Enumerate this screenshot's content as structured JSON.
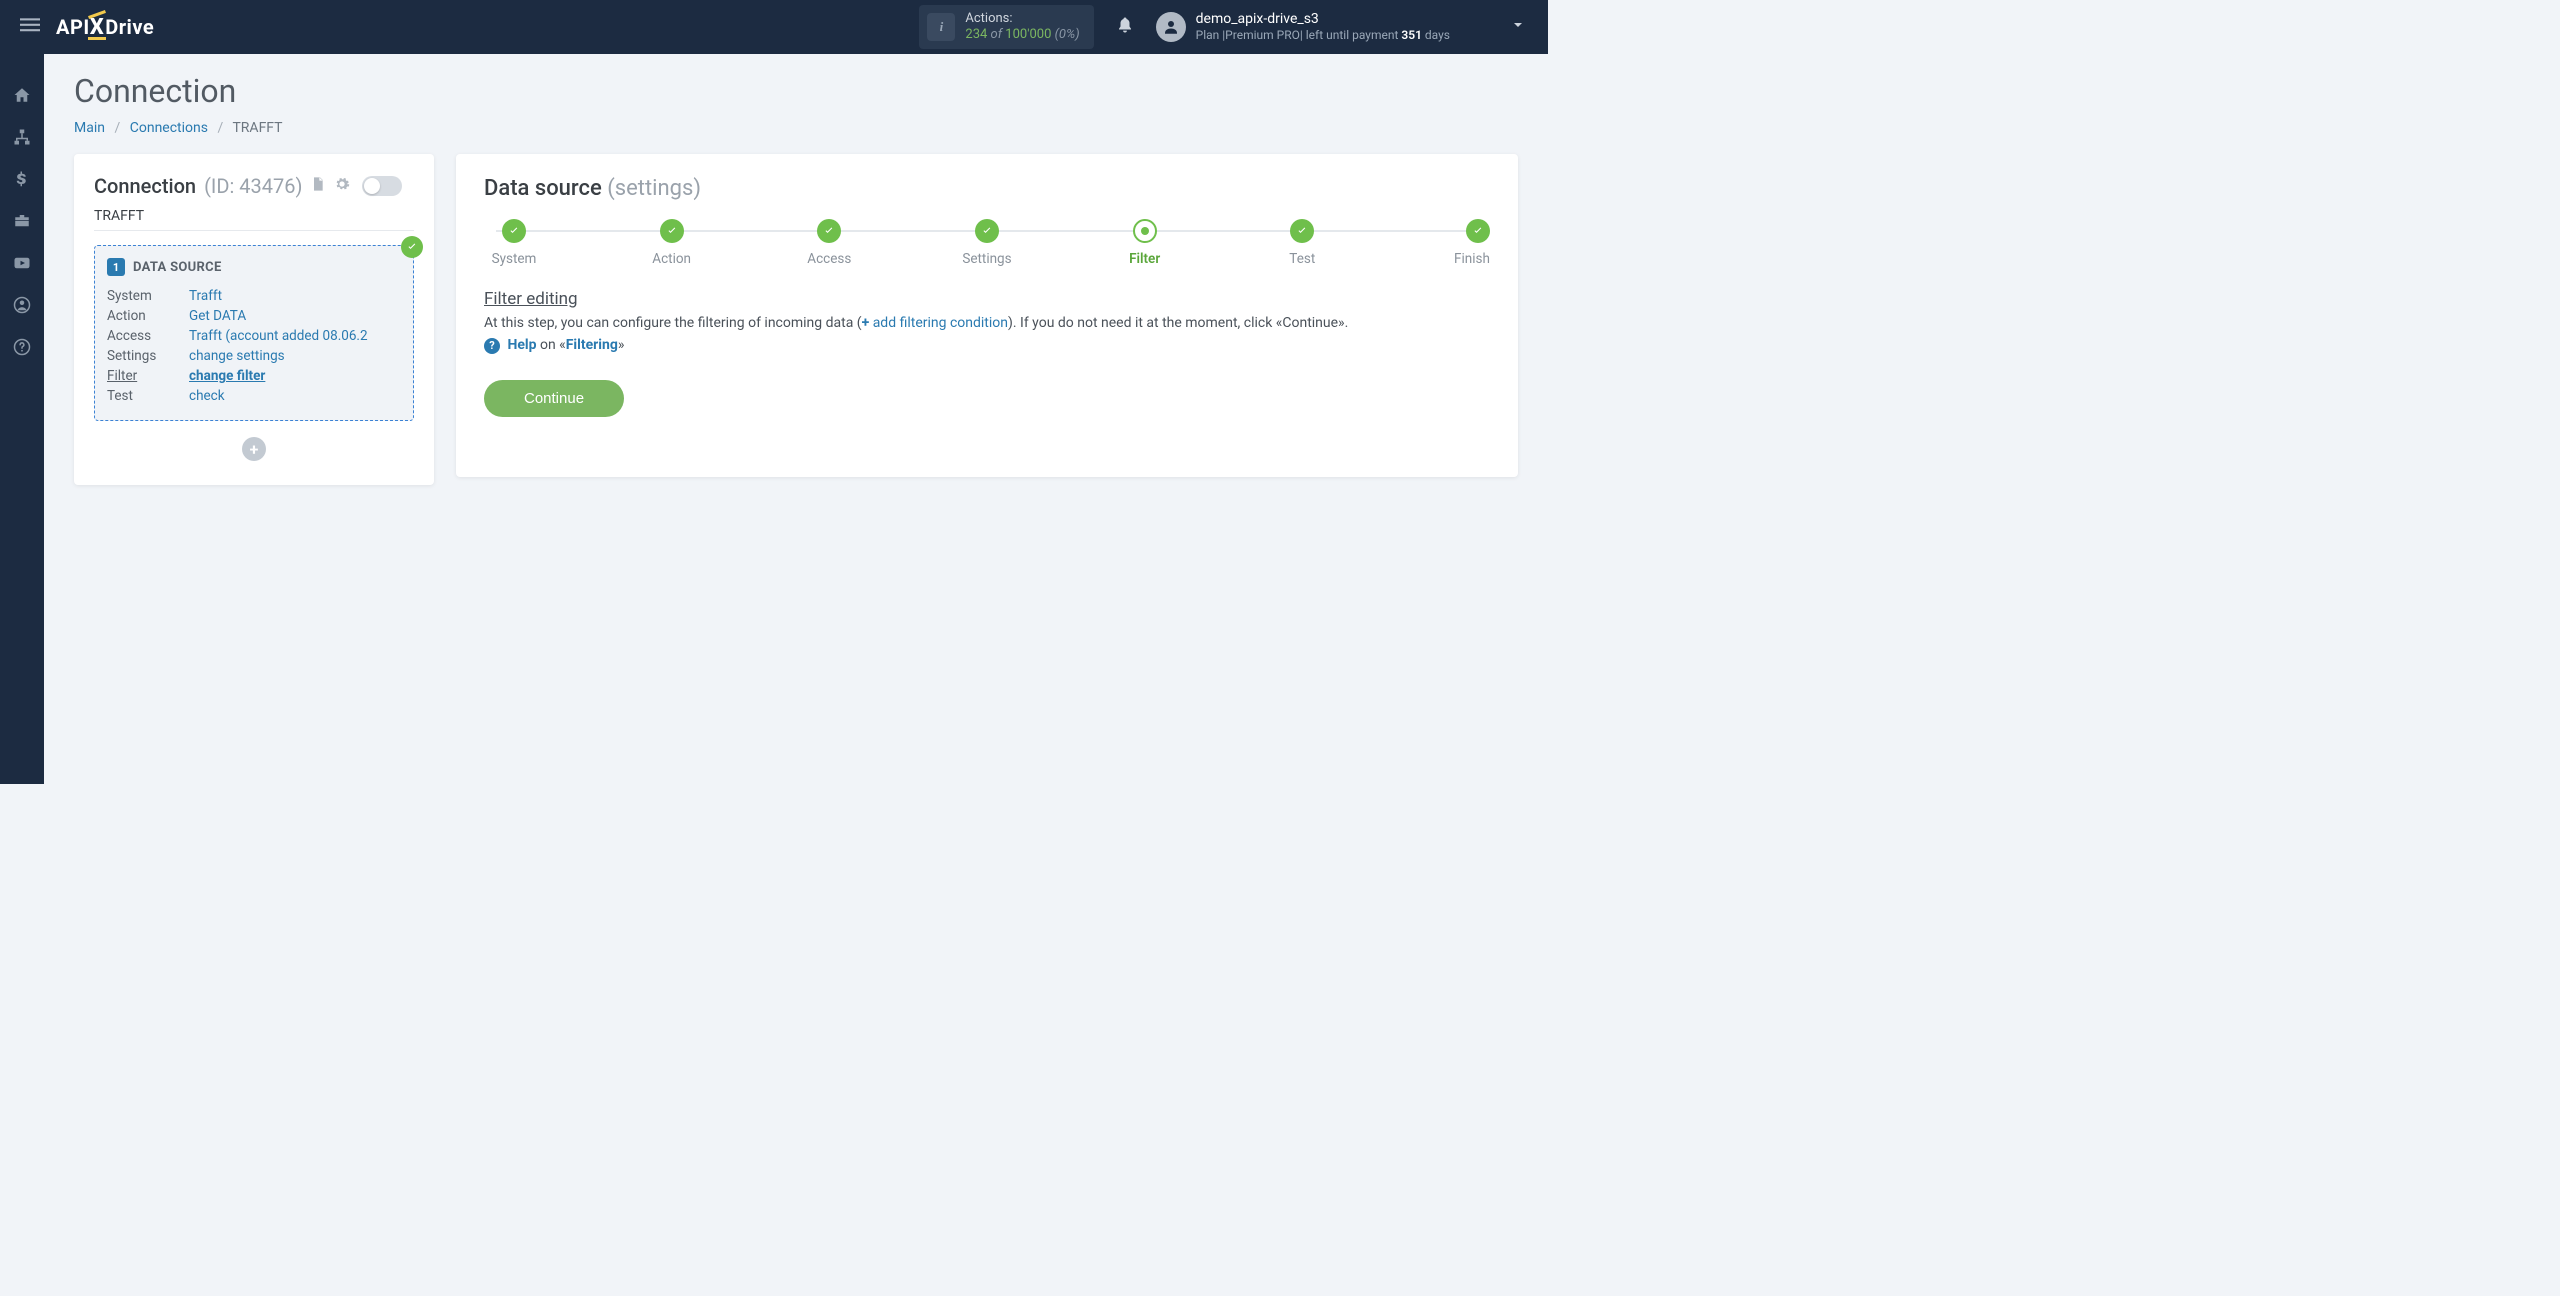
{
  "topbar": {
    "actions_label": "Actions:",
    "actions_used": "234",
    "actions_of": " of ",
    "actions_total": "100'000",
    "actions_pct": " (0%)",
    "user_name": "demo_apix-drive_s3",
    "plan_prefix": "Plan  |Premium PRO|  left until payment ",
    "plan_days": "351",
    "plan_suffix": " days"
  },
  "page": {
    "title": "Connection",
    "crumb_main": "Main",
    "crumb_connections": "Connections",
    "crumb_current": "TRAFFT"
  },
  "left": {
    "title": "Connection",
    "id_label": "(ID: 43476)",
    "name": "TRAFFT",
    "block_number": "1",
    "block_title": "DATA SOURCE",
    "rows": [
      {
        "label": "System",
        "value": "Trafft",
        "active": false
      },
      {
        "label": "Action",
        "value": "Get DATA",
        "active": false
      },
      {
        "label": "Access",
        "value": "Trafft (account added 08.06.2",
        "active": false
      },
      {
        "label": "Settings",
        "value": "change settings",
        "active": false
      },
      {
        "label": "Filter",
        "value": "change filter",
        "active": true
      },
      {
        "label": "Test",
        "value": "check",
        "active": false
      }
    ]
  },
  "right": {
    "title": "Data source",
    "subtitle": "(settings)",
    "steps": [
      {
        "label": "System",
        "state": "done"
      },
      {
        "label": "Action",
        "state": "done"
      },
      {
        "label": "Access",
        "state": "done"
      },
      {
        "label": "Settings",
        "state": "done"
      },
      {
        "label": "Filter",
        "state": "current"
      },
      {
        "label": "Test",
        "state": "done"
      },
      {
        "label": "Finish",
        "state": "done"
      }
    ],
    "section_title": "Filter editing",
    "desc_a": "At this step, you can configure the filtering of incoming data (",
    "desc_link": " add filtering condition",
    "desc_b": "). If you do not need it at the moment, click «Continue».",
    "help": "Help",
    "help_on": " on «",
    "help_topic": "Filtering",
    "help_close": "»",
    "continue": "Continue"
  }
}
